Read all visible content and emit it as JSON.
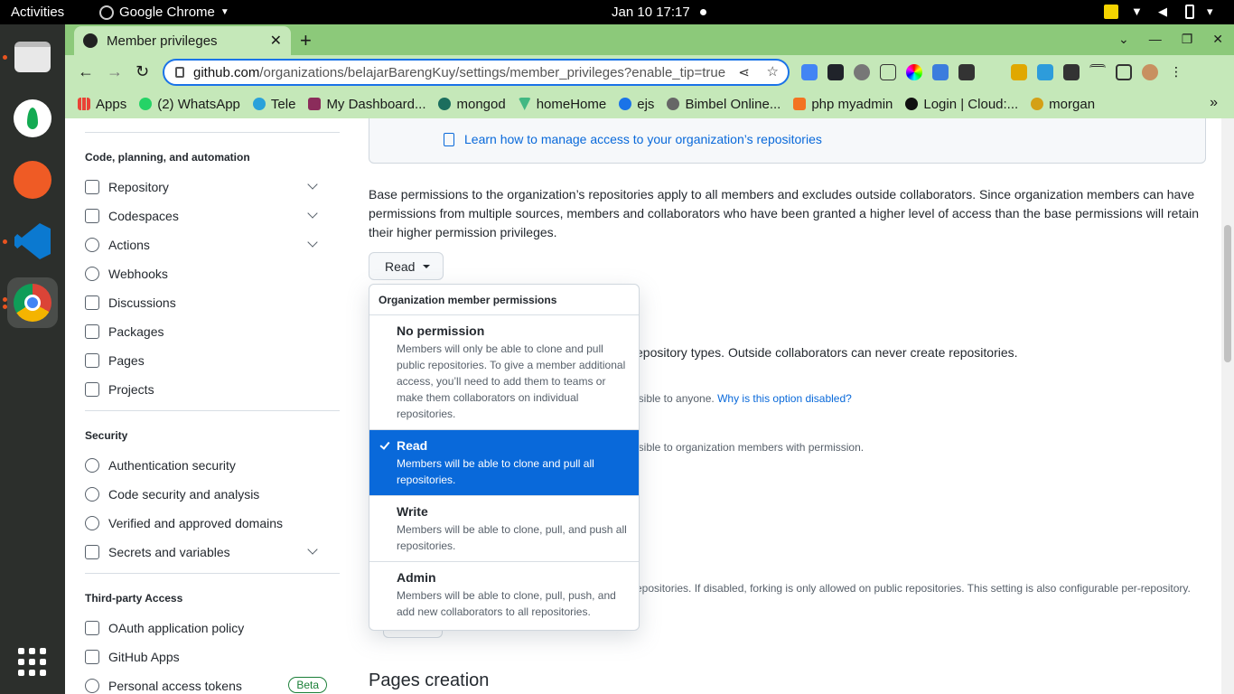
{
  "system": {
    "activities": "Activities",
    "app_name": "Google Chrome",
    "clock": "Jan 10  17:17"
  },
  "browser": {
    "tab_title": "Member privileges",
    "url_host": "github.com",
    "url_path": "/organizations/belajarBarengKuy/settings/member_privileges?enable_tip=true",
    "bookmarks": [
      "Apps",
      "(2) WhatsApp",
      "Tele",
      "My Dashboard...",
      "mongod",
      "homeHome",
      "ejs",
      "Bimbel Online...",
      "php myadmin",
      "Login | Cloud:...",
      "morgan"
    ]
  },
  "sidebar": {
    "section_code": "Code, planning, and automation",
    "code_items": [
      "Repository",
      "Codespaces",
      "Actions",
      "Webhooks",
      "Discussions",
      "Packages",
      "Pages",
      "Projects"
    ],
    "section_security": "Security",
    "security_items": [
      "Authentication security",
      "Code security and analysis",
      "Verified and approved domains",
      "Secrets and variables"
    ],
    "section_third_party": "Third-party Access",
    "third_party_items": [
      "OAuth application policy",
      "GitHub Apps",
      "Personal access tokens"
    ],
    "beta_badge": "Beta"
  },
  "main": {
    "learn_link": "Learn how to manage access to your organization’s repositories",
    "base_permissions_text": "Base permissions to the organization’s repositories apply to all members and excludes outside collaborators. Since organization members can have permissions from multiple sources, members and collaborators who have been granted a higher level of access than the base permissions will retain their higher permission privileges.",
    "base_permission_value": "Read",
    "bg_repo_types": "epository types. Outside collaborators can never create repositories.",
    "bg_public": "isible to anyone.",
    "bg_public_link": "Why is this option disabled?",
    "bg_private": "isible to organization members with permission.",
    "bg_forking": "epositories. If disabled, forking is only allowed on public repositories. This setting is also configurable per-repository.",
    "pages_heading": "Pages creation"
  },
  "menu": {
    "header": "Organization member permissions",
    "options": [
      {
        "title": "No permission",
        "desc": "Members will only be able to clone and pull public repositories. To give a member additional access, you’ll need to add them to teams or make them collaborators on individual repositories."
      },
      {
        "title": "Read",
        "desc": "Members will be able to clone and pull all repositories."
      },
      {
        "title": "Write",
        "desc": "Members will be able to clone, pull, and push all repositories."
      },
      {
        "title": "Admin",
        "desc": "Members will be able to clone, pull, push, and add new collaborators to all repositories."
      }
    ],
    "selected": "Read"
  },
  "colors": {
    "accent": "#0969da",
    "chrome_frame": "#8cc97a",
    "chrome_toolbar": "#c5e8b9"
  }
}
